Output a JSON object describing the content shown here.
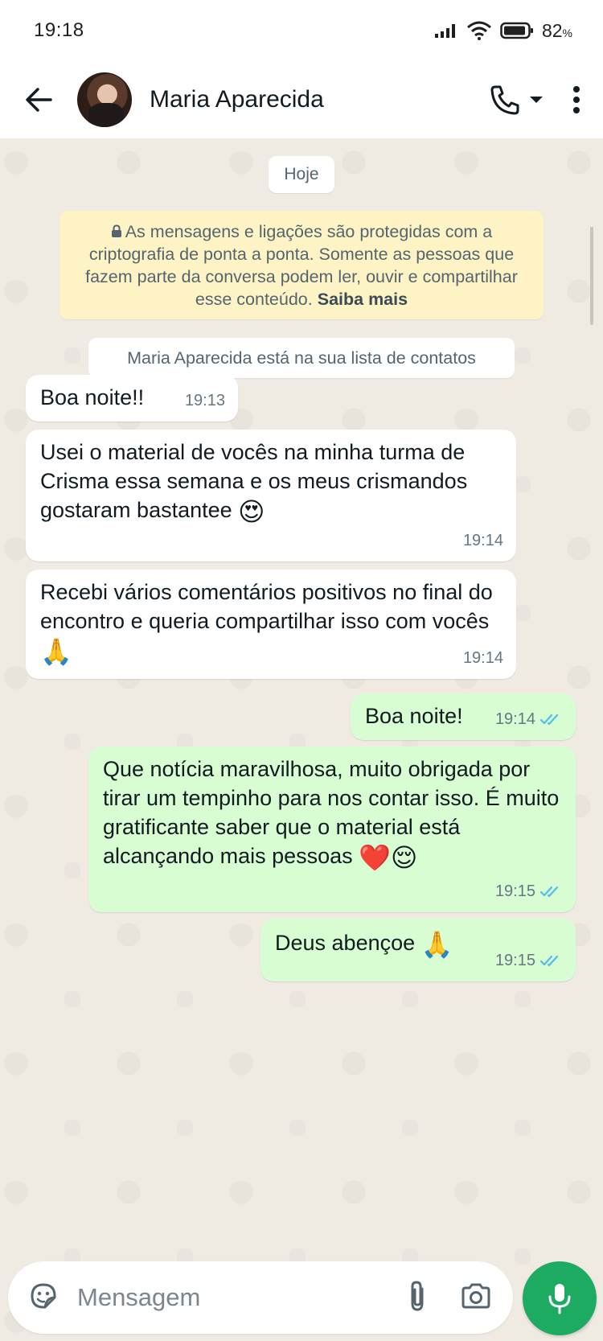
{
  "status_bar": {
    "time": "19:18",
    "battery_percent": "82",
    "battery_unit": "%"
  },
  "header": {
    "contact_name": "Maria Aparecida",
    "back_icon": "arrow-left-icon",
    "call_icon": "phone-icon",
    "more_icon": "three-dots-icon"
  },
  "chat": {
    "date_chip": "Hoje",
    "encryption_notice": "As mensagens e ligações são protegidas com a criptografia de ponta a ponta. Somente as pessoas que fazem parte da conversa podem ler, ouvir e compartilhar esse conteúdo.",
    "encryption_link": "Saiba mais",
    "contact_notice": "Maria Aparecida está na sua lista de contatos",
    "messages": [
      {
        "direction": "in",
        "text": "Boa noite!!",
        "time": "19:13"
      },
      {
        "direction": "in",
        "text": "Usei o material de vocês na minha turma de Crisma essa semana e os meus crismandos gostaram bastantee",
        "emoji": "😍",
        "time": "19:14"
      },
      {
        "direction": "in",
        "text": "Recebi vários comentários positivos no final do encontro e queria compartilhar isso com vocês",
        "emoji": "🙏",
        "time": "19:14"
      },
      {
        "direction": "out",
        "text": "Boa noite!",
        "time": "19:14",
        "status": "read"
      },
      {
        "direction": "out",
        "text": "Que notícia maravilhosa, muito obrigada por tirar um tempinho para nos contar isso. É muito gratificante saber que o material está alcançando mais pessoas",
        "emoji": "❤️😌",
        "time": "19:15",
        "status": "read"
      },
      {
        "direction": "out",
        "text": "Deus abençoe",
        "emoji": "🙏",
        "time": "19:15",
        "status": "read"
      }
    ]
  },
  "composer": {
    "placeholder": "Mensagem"
  },
  "colors": {
    "chat_background": "#efeae2",
    "incoming_bubble": "#ffffff",
    "outgoing_bubble": "#d9fdd3",
    "read_ticks": "#53bdeb",
    "mic_button": "#1daa61",
    "encryption_box": "#fdf3c5"
  }
}
